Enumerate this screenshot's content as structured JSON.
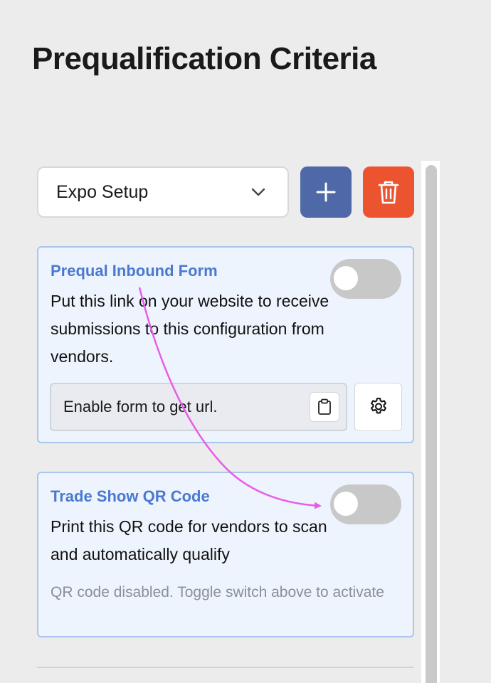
{
  "page": {
    "title": "Prequalification Criteria"
  },
  "toolbar": {
    "select_value": "Expo Setup",
    "add_icon": "plus-icon",
    "delete_icon": "trash-icon",
    "colors": {
      "add": "#4f68a8",
      "delete": "#ec5430"
    }
  },
  "cards": {
    "form": {
      "title": "Prequal Inbound Form",
      "description": "Put this link on your website to receive submissions to this configuration from vendors.",
      "toggle_on": false,
      "url_placeholder": "Enable form to get url.",
      "copy_icon": "clipboard-icon",
      "settings_icon": "gear-icon"
    },
    "qr": {
      "title": "Trade Show QR Code",
      "description": "Print this QR code for vendors to scan and automatically qualify",
      "toggle_on": false,
      "note": "QR code disabled. Toggle switch above to activate"
    }
  },
  "accent_color": "#4a79d1"
}
